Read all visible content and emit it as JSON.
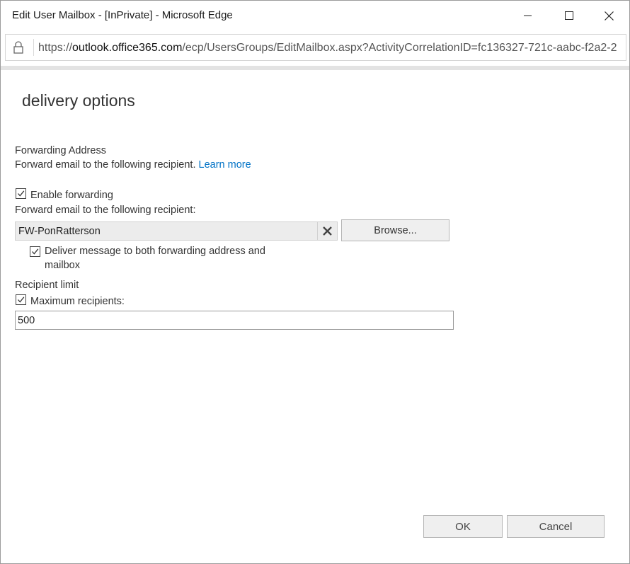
{
  "window": {
    "title": "Edit User Mailbox - [InPrivate] - Microsoft Edge"
  },
  "address_bar": {
    "url_prefix": "https://",
    "url_domain": "outlook.office365.com",
    "url_path": "/ecp/UsersGroups/EditMailbox.aspx?ActivityCorrelationID=fc136327-721c-aabc-f2a2-2"
  },
  "page": {
    "heading": "delivery options",
    "forwarding": {
      "section_title": "Forwarding Address",
      "description": "Forward email to the following recipient.",
      "learn_more": "Learn more",
      "enable_label": "Enable forwarding",
      "enable_checked": true,
      "recipient_label": "Forward email to the following recipient:",
      "recipient_value": "FW-PonRatterson",
      "browse_label": "Browse...",
      "deliver_both_line1": "Deliver message to both forwarding address and",
      "deliver_both_line2": "mailbox",
      "deliver_both_checked": true
    },
    "recipient_limit": {
      "section_title": "Recipient limit",
      "max_label": "Maximum recipients:",
      "max_checked": true,
      "max_value": "500"
    }
  },
  "footer": {
    "ok_label": "OK",
    "cancel_label": "Cancel"
  }
}
